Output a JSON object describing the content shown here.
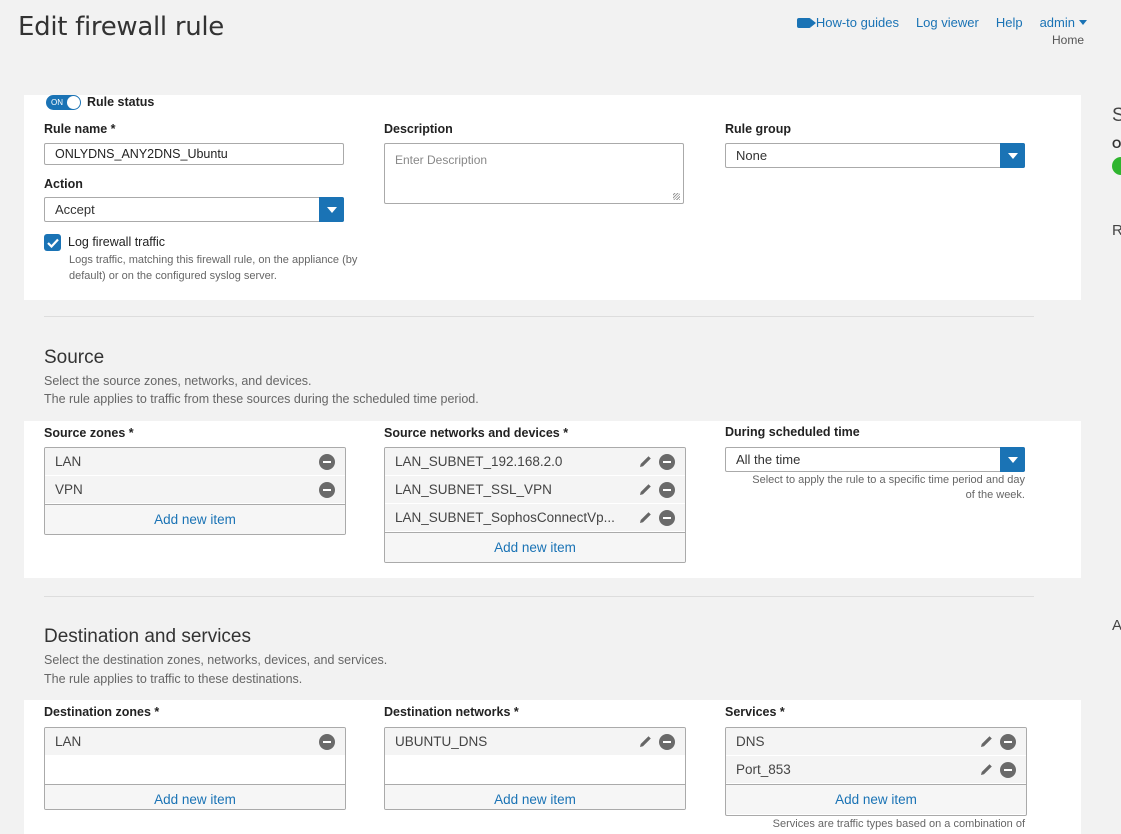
{
  "page": {
    "title": "Edit firewall rule"
  },
  "topnav": {
    "howto": "How-to guides",
    "logviewer": "Log viewer",
    "help": "Help",
    "user": "admin",
    "home": "Home"
  },
  "rule": {
    "status_toggle": "ON",
    "status_label": "Rule status",
    "name_label": "Rule name *",
    "name_value": "ONLYDNS_ANY2DNS_Ubuntu",
    "description_label": "Description",
    "description_placeholder": "Enter Description",
    "group_label": "Rule group",
    "group_value": "None",
    "action_label": "Action",
    "action_value": "Accept",
    "log_label": "Log firewall traffic",
    "log_checked": true,
    "log_help": "Logs traffic, matching this firewall rule, on the appliance (by default) or on the configured syslog server."
  },
  "source": {
    "heading": "Source",
    "sub1": "Select the source zones, networks, and devices.",
    "sub2": "The rule applies to traffic from these sources during the scheduled time period.",
    "zones_label": "Source zones *",
    "zones": [
      "LAN",
      "VPN"
    ],
    "networks_label": "Source networks and devices *",
    "networks": [
      "LAN_SUBNET_192.168.2.0",
      "LAN_SUBNET_SSL_VPN",
      "LAN_SUBNET_SophosConnectVp..."
    ],
    "schedule_label": "During scheduled time",
    "schedule_value": "All the time",
    "schedule_hint": "Select to apply the rule to a specific time period and day of the week.",
    "add_item": "Add new item"
  },
  "destination": {
    "heading": "Destination and services",
    "sub1": "Select the destination zones, networks, devices, and services.",
    "sub2": "The rule applies to traffic to these destinations.",
    "zones_label": "Destination zones *",
    "zones": [
      "LAN"
    ],
    "networks_label": "Destination networks *",
    "networks": [
      "UBUNTU_DNS"
    ],
    "services_label": "Services *",
    "services": [
      "DNS",
      "Port_853"
    ],
    "services_hint": "Services are traffic types based on a combination of",
    "add_item": "Add new item"
  },
  "colors": {
    "accent": "#1a73b5",
    "status_on": "#2fb52f"
  }
}
